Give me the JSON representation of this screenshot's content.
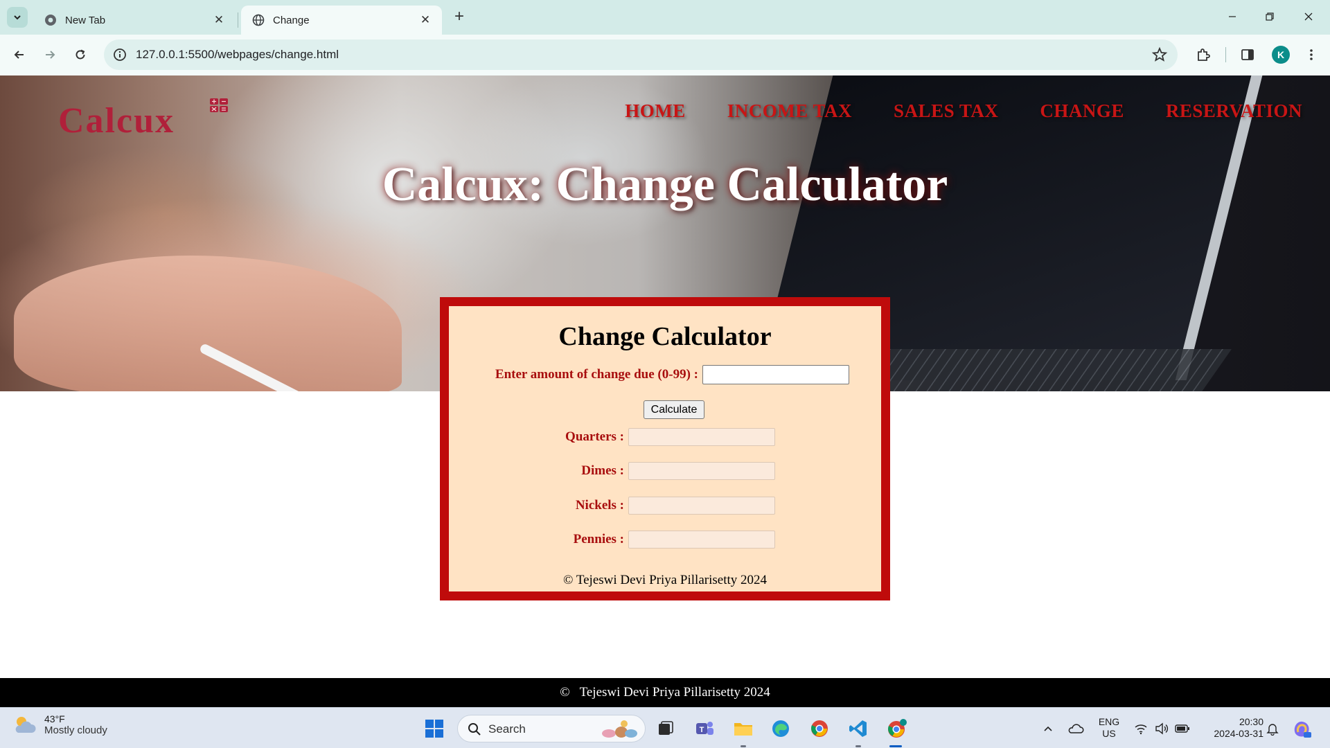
{
  "browser": {
    "tabs": [
      {
        "title": "New Tab",
        "active": false
      },
      {
        "title": "Change",
        "active": true
      }
    ],
    "url": "127.0.0.1:5500/webpages/change.html",
    "profile_initial": "K"
  },
  "site": {
    "logo": "Calcux",
    "nav": [
      "HOME",
      "INCOME TAX",
      "SALES TAX",
      "CHANGE",
      "RESERVATION"
    ],
    "hero_title": "Calcux: Change Calculator"
  },
  "calculator": {
    "title": "Change Calculator",
    "amount_label": "Enter amount of change due (0-99) :",
    "amount_value": "",
    "button_label": "Calculate",
    "outputs": [
      {
        "label": "Quarters :",
        "value": ""
      },
      {
        "label": "Dimes :",
        "value": ""
      },
      {
        "label": "Nickels :",
        "value": ""
      },
      {
        "label": "Pennies :",
        "value": ""
      }
    ],
    "copyright": "© Tejeswi Devi Priya Pillarisetty 2024"
  },
  "footer": {
    "copyright": "©   Tejeswi Devi Priya Pillarisetty 2024"
  },
  "taskbar": {
    "weather_temp": "43°F",
    "weather_condition": "Mostly cloudy",
    "search_label": "Search",
    "language": "ENG",
    "region": "US",
    "time": "20:30",
    "date": "2024-03-31"
  },
  "colors": {
    "brand_red": "#c81515",
    "card_border": "#bf0b0b",
    "card_background": "#ffe3c4",
    "label_red": "#a80e0e"
  }
}
